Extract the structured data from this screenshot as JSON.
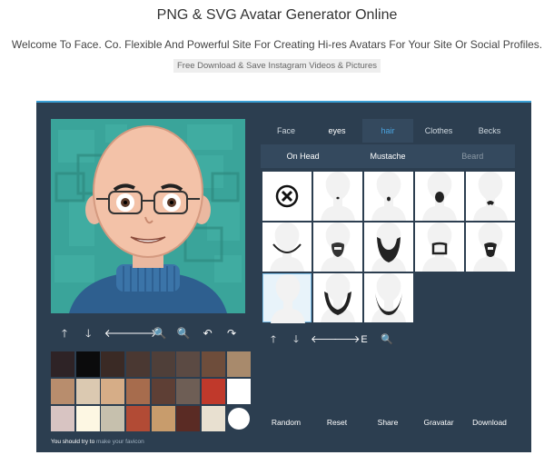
{
  "header": {
    "title": "PNG & SVG Avatar Generator Online",
    "subtitle": "Welcome To Face. Co. Flexible And Powerful Site For Creating Hi-res Avatars For Your Site Or Social Profiles.",
    "promo_link": "Free Download & Save Instagram Videos & Pictures"
  },
  "toolbar": {
    "icons": [
      "up-arrow-icon",
      "down-arrow-icon",
      "left-arrow-icon",
      "right-arrow-icon",
      "zoom-out-icon",
      "zoom-in-icon",
      "rotate-left-icon",
      "rotate-right-icon"
    ],
    "glyphs": [
      "🡑",
      "🡓",
      "🡐",
      "🡒",
      "🔍",
      "🔍",
      "↶",
      "↷"
    ]
  },
  "palette": {
    "colors": [
      "#2e2326",
      "#0b0b0c",
      "#3a2a25",
      "#4a3832",
      "#4f3f39",
      "#5b4a43",
      "#6e4d3b",
      "#a88a6c",
      "#b88d6d",
      "#dbc9b1",
      "#d6ad87",
      "#a76c4d",
      "#5e3f35",
      "#6e5e55",
      "#c0392b",
      "#ffffff",
      "#d8c4c2",
      "#fdf7e3",
      "#c6c0ad",
      "#b24b35",
      "#c89c6c",
      "#5a2b24",
      "#e8e0d0",
      "#ffffff"
    ]
  },
  "favicon_note": {
    "prefix": "You should try to",
    "link": "make your favicon"
  },
  "category_tabs": [
    {
      "label": "Face",
      "state": "normal"
    },
    {
      "label": "eyes",
      "state": "bright"
    },
    {
      "label": "hair",
      "state": "active"
    },
    {
      "label": "Clothes",
      "state": "normal"
    },
    {
      "label": "Becks",
      "state": "normal"
    }
  ],
  "sub_tabs": [
    {
      "label": "On Head",
      "state": "normal"
    },
    {
      "label": "Mustache",
      "state": "normal"
    },
    {
      "label": "Beard",
      "state": "dim"
    }
  ],
  "beard_options": [
    "none",
    "soul-patch",
    "small-chin",
    "goatee",
    "chin-strap",
    "chin-curve",
    "full-goatee",
    "full-beard",
    "box-goatee",
    "van-dyke",
    "blank",
    "long-chinstrap",
    "curved-chinstrap"
  ],
  "item_tools": {
    "glyphs": [
      "🡑",
      "🡓",
      "🡐",
      "🡒",
      "E",
      "🔍"
    ],
    "icons": [
      "item-up-icon",
      "item-down-icon",
      "item-left-icon",
      "item-right-icon",
      "item-edit-icon",
      "item-zoom-icon"
    ]
  },
  "actions": [
    "Random",
    "Reset",
    "Share",
    "Gravatar",
    "Download"
  ]
}
